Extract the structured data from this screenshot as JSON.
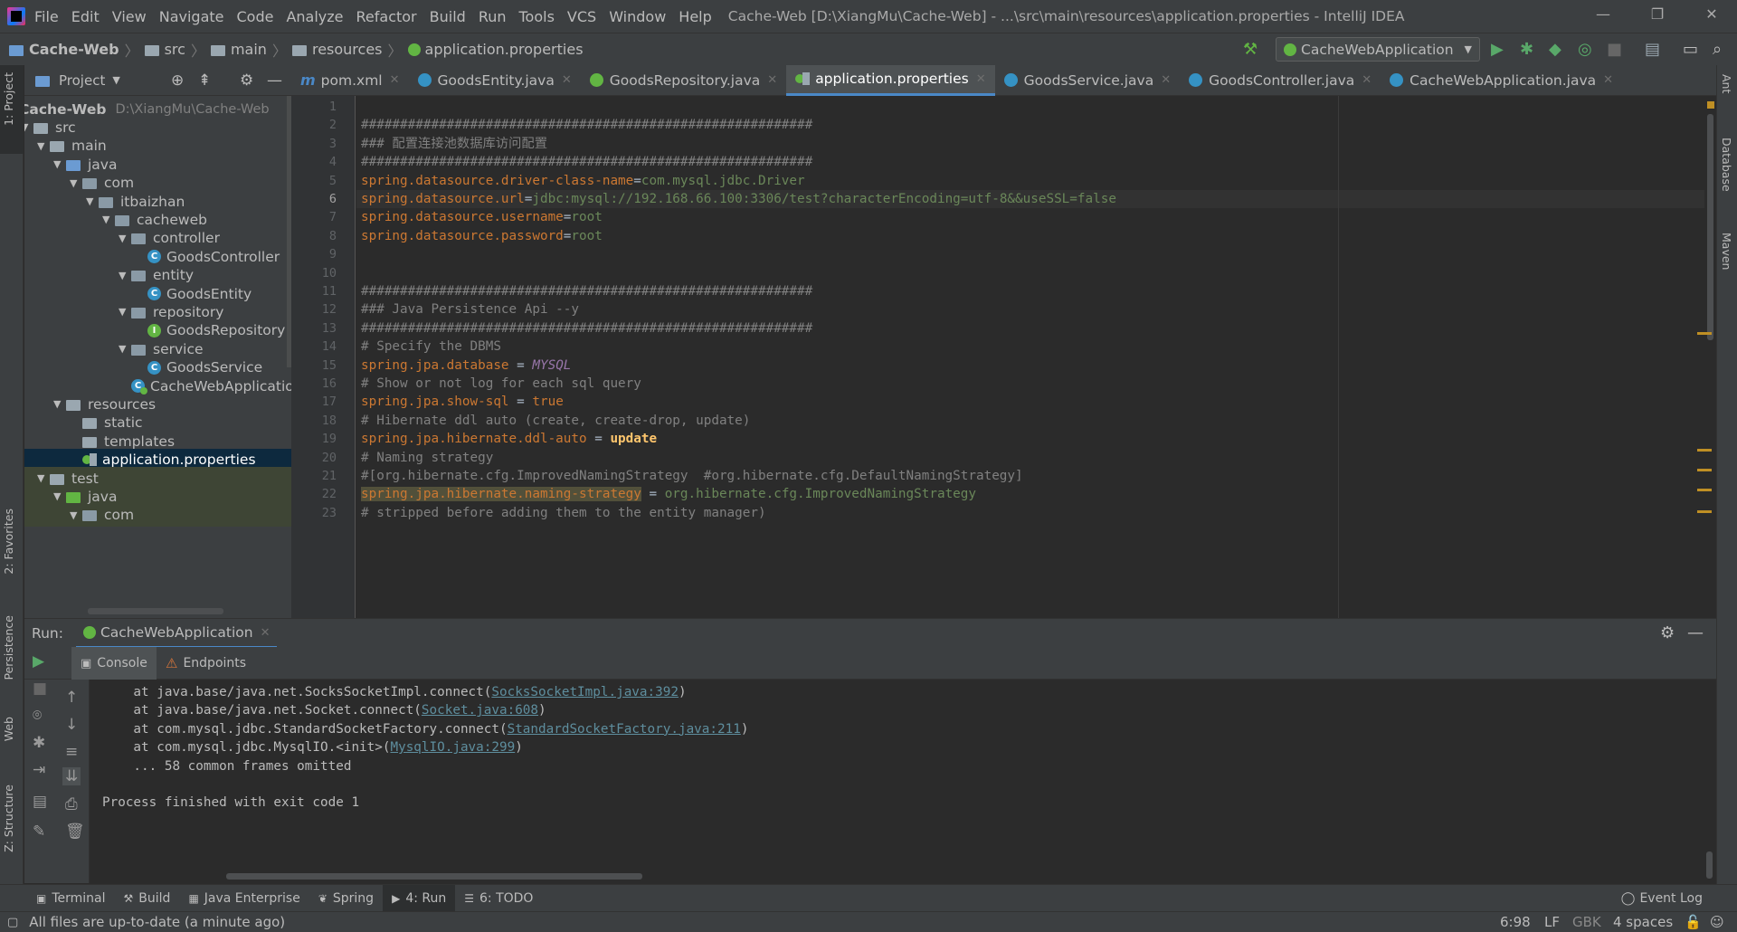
{
  "titlebar": {
    "menus": [
      "File",
      "Edit",
      "View",
      "Navigate",
      "Code",
      "Analyze",
      "Refactor",
      "Build",
      "Run",
      "Tools",
      "VCS",
      "Window",
      "Help"
    ],
    "title": "Cache-Web [D:\\XiangMu\\Cache-Web] - ...\\src\\main\\resources\\application.properties - IntelliJ IDEA",
    "minimize": "—",
    "restore": "❐",
    "close": "✕"
  },
  "navbar": {
    "crumbs": [
      "Cache-Web",
      "src",
      "main",
      "resources",
      "application.properties"
    ],
    "run_config": "CacheWebApplication"
  },
  "left_strip": {
    "project": "1: Project",
    "favorites": "2: Favorites",
    "persistence": "Persistence",
    "web": "Web",
    "structure": "Z: Structure"
  },
  "right_strip": {
    "ant": "Ant",
    "database": "Database",
    "maven": "Maven"
  },
  "project": {
    "header": "Project",
    "root_name": "Cache-Web",
    "root_path": "D:\\XiangMu\\Cache-Web",
    "tree": [
      {
        "label": "src",
        "indent": 0,
        "kind": "folder",
        "arrow": "▼"
      },
      {
        "label": "main",
        "indent": 1,
        "kind": "folder",
        "arrow": "▼"
      },
      {
        "label": "java",
        "indent": 2,
        "kind": "folder-blue",
        "arrow": "▼"
      },
      {
        "label": "com",
        "indent": 3,
        "kind": "package",
        "arrow": "▼"
      },
      {
        "label": "itbaizhan",
        "indent": 4,
        "kind": "package",
        "arrow": "▼"
      },
      {
        "label": "cacheweb",
        "indent": 5,
        "kind": "package",
        "arrow": "▼"
      },
      {
        "label": "controller",
        "indent": 6,
        "kind": "package",
        "arrow": "▼"
      },
      {
        "label": "GoodsController",
        "indent": 7,
        "kind": "class",
        "arrow": ""
      },
      {
        "label": "entity",
        "indent": 6,
        "kind": "package",
        "arrow": "▼"
      },
      {
        "label": "GoodsEntity",
        "indent": 7,
        "kind": "class",
        "arrow": ""
      },
      {
        "label": "repository",
        "indent": 6,
        "kind": "package",
        "arrow": "▼"
      },
      {
        "label": "GoodsRepository",
        "indent": 7,
        "kind": "interface",
        "arrow": ""
      },
      {
        "label": "service",
        "indent": 6,
        "kind": "package",
        "arrow": "▼"
      },
      {
        "label": "GoodsService",
        "indent": 7,
        "kind": "class",
        "arrow": ""
      },
      {
        "label": "CacheWebApplication",
        "indent": 6,
        "kind": "spring",
        "arrow": ""
      },
      {
        "label": "resources",
        "indent": 2,
        "kind": "folder",
        "arrow": "▼"
      },
      {
        "label": "static",
        "indent": 3,
        "kind": "folder",
        "arrow": ""
      },
      {
        "label": "templates",
        "indent": 3,
        "kind": "folder",
        "arrow": ""
      },
      {
        "label": "application.properties",
        "indent": 3,
        "kind": "props",
        "arrow": "",
        "selected": true
      },
      {
        "label": "test",
        "indent": 1,
        "kind": "folder",
        "arrow": "▼",
        "test": true
      },
      {
        "label": "java",
        "indent": 2,
        "kind": "folder-green",
        "arrow": "▼",
        "test": true
      },
      {
        "label": "com",
        "indent": 3,
        "kind": "package",
        "arrow": "▼",
        "test": true
      }
    ]
  },
  "tabs": [
    {
      "label": "pom.xml",
      "icon": "m"
    },
    {
      "label": "GoodsEntity.java",
      "icon": "class"
    },
    {
      "label": "GoodsRepository.java",
      "icon": "interface"
    },
    {
      "label": "application.properties",
      "icon": "props",
      "active": true
    },
    {
      "label": "GoodsService.java",
      "icon": "class"
    },
    {
      "label": "GoodsController.java",
      "icon": "class"
    },
    {
      "label": "CacheWebApplication.java",
      "icon": "spring"
    }
  ],
  "editor": {
    "current_line": 6,
    "lines": [
      [],
      [
        {
          "t": "##########################################################",
          "c": "c-cm"
        }
      ],
      [
        {
          "t": "### 配置连接池数据库访问配置",
          "c": "c-cm"
        }
      ],
      [
        {
          "t": "##########################################################",
          "c": "c-cm"
        }
      ],
      [
        {
          "t": "spring.datasource.driver-class-name",
          "c": "c-key"
        },
        {
          "t": "=",
          "c": ""
        },
        {
          "t": "com.mysql.jdbc.Driver",
          "c": "c-val"
        }
      ],
      [
        {
          "t": "spring.datasource.url",
          "c": "c-key"
        },
        {
          "t": "=",
          "c": ""
        },
        {
          "t": "jdbc:mysql://192.168.66.100:3306/test?characterEncoding=utf-8&&useSSL=false",
          "c": "c-val"
        }
      ],
      [
        {
          "t": "spring.datasource.username",
          "c": "c-key"
        },
        {
          "t": "=",
          "c": ""
        },
        {
          "t": "root",
          "c": "c-val"
        }
      ],
      [
        {
          "t": "spring.datasource.password",
          "c": "c-key"
        },
        {
          "t": "=",
          "c": ""
        },
        {
          "t": "root",
          "c": "c-val"
        }
      ],
      [],
      [],
      [
        {
          "t": "##########################################################",
          "c": "c-cm"
        }
      ],
      [
        {
          "t": "### Java Persistence Api --y",
          "c": "c-cm"
        }
      ],
      [
        {
          "t": "##########################################################",
          "c": "c-cm"
        }
      ],
      [
        {
          "t": "# Specify the DBMS",
          "c": "c-cm"
        }
      ],
      [
        {
          "t": "spring.jpa.database",
          "c": "c-key"
        },
        {
          "t": " = ",
          "c": ""
        },
        {
          "t": "MYSQL",
          "c": "c-it"
        }
      ],
      [
        {
          "t": "# Show or not log for each sql query",
          "c": "c-cm"
        }
      ],
      [
        {
          "t": "spring.jpa.show-sql",
          "c": "c-key"
        },
        {
          "t": " = ",
          "c": ""
        },
        {
          "t": "true",
          "c": "c-kw"
        }
      ],
      [
        {
          "t": "# Hibernate ddl auto (create, create-drop, update)",
          "c": "c-cm"
        }
      ],
      [
        {
          "t": "spring.jpa.hibernate.ddl-auto",
          "c": "c-key"
        },
        {
          "t": " = ",
          "c": ""
        },
        {
          "t": "update",
          "c": "c-bold"
        }
      ],
      [
        {
          "t": "# Naming strategy",
          "c": "c-cm"
        }
      ],
      [
        {
          "t": "#[org.hibernate.cfg.ImprovedNamingStrategy  #org.hibernate.cfg.DefaultNamingStrategy]",
          "c": "c-cm"
        }
      ],
      [
        {
          "t": "spring.jpa.hibernate.naming-strategy",
          "c": "c-hl"
        },
        {
          "t": " = ",
          "c": ""
        },
        {
          "t": "org.hibernate.cfg.ImprovedNamingStrategy",
          "c": "c-val"
        }
      ],
      [
        {
          "t": "# stripped before adding them to the entity manager)",
          "c": "c-cm"
        }
      ]
    ]
  },
  "run": {
    "label": "Run:",
    "tab": "CacheWebApplication",
    "console_tab": "Console",
    "endpoints_tab": "Endpoints",
    "console": [
      {
        "pre": "    at java.base/java.net.SocksSocketImpl.connect(",
        "link": "SocksSocketImpl.java:392",
        "post": ")"
      },
      {
        "pre": "    at java.base/java.net.Socket.connect(",
        "link": "Socket.java:608",
        "post": ")"
      },
      {
        "pre": "    at com.mysql.jdbc.StandardSocketFactory.connect(",
        "link": "StandardSocketFactory.java:211",
        "post": ")"
      },
      {
        "pre": "    at com.mysql.jdbc.MysqlIO.<init>(",
        "link": "MysqlIO.java:299",
        "post": ")"
      },
      {
        "pre": "    ... 58 common frames omitted",
        "link": "",
        "post": ""
      },
      {
        "pre": "",
        "link": "",
        "post": ""
      },
      {
        "pre": "Process finished with exit code 1",
        "link": "",
        "post": ""
      }
    ]
  },
  "bottom_tabs": [
    {
      "label": "Terminal",
      "icon": "▣"
    },
    {
      "label": "Build",
      "icon": "⚒"
    },
    {
      "label": "Java Enterprise",
      "icon": "▦"
    },
    {
      "label": "Spring",
      "icon": "❦"
    },
    {
      "label": "4: Run",
      "icon": "▶",
      "active": true
    },
    {
      "label": "6: TODO",
      "icon": "☰"
    }
  ],
  "event_log": "Event Log",
  "status": {
    "message": "All files are up-to-date (a minute ago)",
    "position": "6:98",
    "line_sep": "LF",
    "encoding": "GBK",
    "indent": "4 spaces"
  }
}
